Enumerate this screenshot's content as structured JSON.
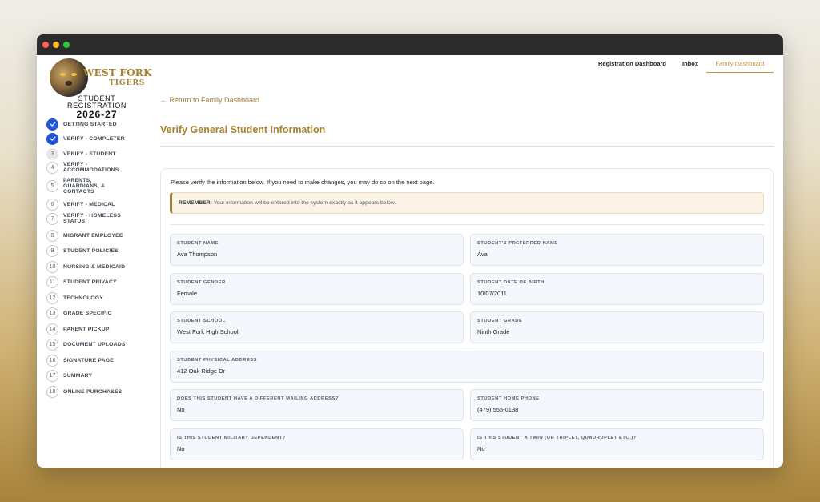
{
  "logo": {
    "line1": "WEST FORK",
    "line2": "TIGERS"
  },
  "registration": {
    "title_line1": "STUDENT",
    "title_line2": "REGISTRATION",
    "year": "2026-27"
  },
  "steps": [
    {
      "num": "",
      "label": "GETTING STARTED",
      "state": "done"
    },
    {
      "num": "",
      "label": "VERIFY - COMPLETER",
      "state": "done"
    },
    {
      "num": "3",
      "label": "VERIFY - STUDENT",
      "state": "current"
    },
    {
      "num": "4",
      "label": "VERIFY - ACCOMMODATIONS",
      "state": "todo"
    },
    {
      "num": "5",
      "label": "PARENTS, GUARDIANS, & CONTACTS",
      "state": "todo"
    },
    {
      "num": "6",
      "label": "VERIFY - MEDICAL",
      "state": "todo"
    },
    {
      "num": "7",
      "label": "VERIFY - HOMELESS STATUS",
      "state": "todo"
    },
    {
      "num": "8",
      "label": "MIGRANT EMPLOYEE",
      "state": "todo"
    },
    {
      "num": "9",
      "label": "STUDENT POLICIES",
      "state": "todo"
    },
    {
      "num": "10",
      "label": "NURSING & MEDICAID",
      "state": "todo"
    },
    {
      "num": "11",
      "label": "STUDENT PRIVACY",
      "state": "todo"
    },
    {
      "num": "12",
      "label": "TECHNOLOGY",
      "state": "todo"
    },
    {
      "num": "13",
      "label": "GRADE SPECIFIC",
      "state": "todo"
    },
    {
      "num": "14",
      "label": "PARENT PICKUP",
      "state": "todo"
    },
    {
      "num": "15",
      "label": "DOCUMENT UPLOADS",
      "state": "todo"
    },
    {
      "num": "16",
      "label": "SIGNATURE PAGE",
      "state": "todo"
    },
    {
      "num": "17",
      "label": "SUMMARY",
      "state": "todo"
    },
    {
      "num": "18",
      "label": "ONLINE PURCHASES",
      "state": "todo"
    }
  ],
  "nav": {
    "registration_dashboard": "Registration Dashboard",
    "inbox": "Inbox",
    "family_dashboard": "Family Dashboard"
  },
  "back_link": "← Return to Family Dashboard",
  "page_title": "Verify General Student Information",
  "intro": "Please verify the information below. If you need to make changes, you may do so on the next page.",
  "remember": {
    "label": "REMEMBER:",
    "text": "Your information will be entered into the system exactly as it appears below."
  },
  "fields": {
    "student_name": {
      "label": "STUDENT NAME",
      "value": "Ava Thompson"
    },
    "preferred_name": {
      "label": "STUDENT'S PREFERRED NAME",
      "value": "Ava"
    },
    "gender": {
      "label": "STUDENT GENDER",
      "value": "Female"
    },
    "dob": {
      "label": "STUDENT DATE OF BIRTH",
      "value": "10/07/2011"
    },
    "school": {
      "label": "STUDENT SCHOOL",
      "value": "West Fork High School"
    },
    "grade": {
      "label": "STUDENT GRADE",
      "value": "Ninth Grade"
    },
    "address": {
      "label": "STUDENT PHYSICAL ADDRESS",
      "value": "412 Oak Ridge Dr"
    },
    "mailing": {
      "label": "DOES THIS STUDENT HAVE A DIFFERENT MAILING ADDRESS?",
      "value": "No"
    },
    "phone": {
      "label": "STUDENT HOME PHONE",
      "value": "(479) 555-0138"
    },
    "military": {
      "label": "IS THIS STUDENT MILITARY DEPENDENT?",
      "value": "No"
    },
    "twin": {
      "label": "IS THIS STUDENT A TWIN (OR TRIPLET, QUADRUPLET ETC.)?",
      "value": "No"
    }
  }
}
